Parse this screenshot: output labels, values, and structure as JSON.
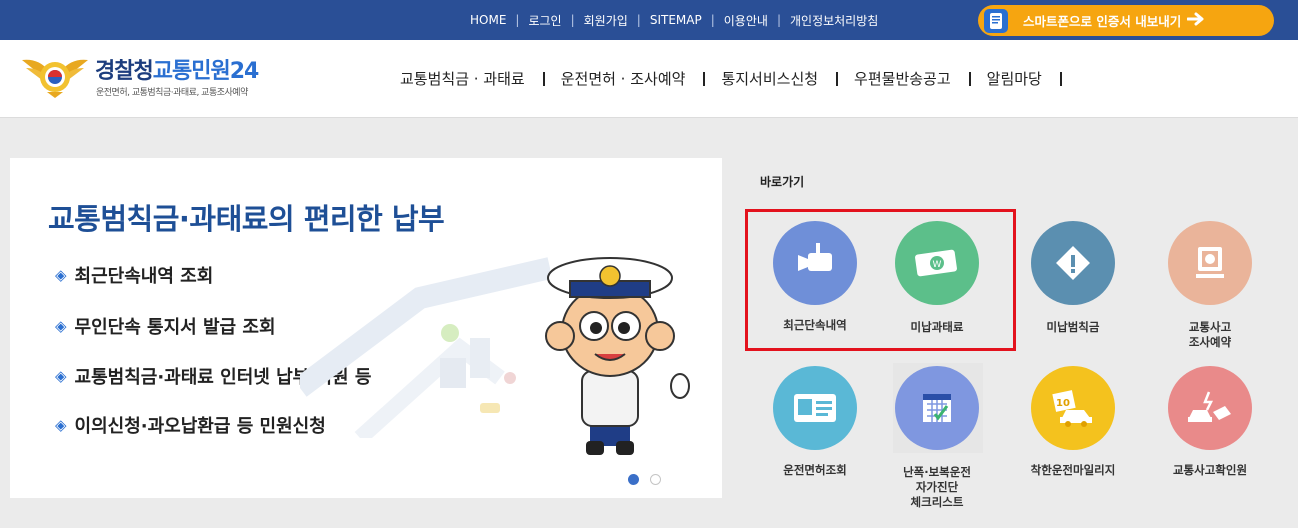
{
  "topbar": {
    "links": [
      "HOME",
      "로그인",
      "회원가입",
      "SITEMAP",
      "이용안내",
      "개인정보처리방침"
    ],
    "smart_label": "스마트폰으로 인증서 내보내기"
  },
  "header": {
    "logo_title_main": "경찰청",
    "logo_title_accent": "교통민원24",
    "logo_subtitle": "운전면허, 교통범칙금·과태료, 교통조사예약",
    "gnb": [
      "교통범칙금 · 과태료",
      "운전면허 · 조사예약",
      "통지서비스신청",
      "우편물반송공고",
      "알림마당"
    ]
  },
  "banner": {
    "title": "교통범칙금·과태료의 편리한 납부",
    "items": [
      "최근단속내역 조회",
      "무인단속 통지서 발급 조회",
      "교통범칙금·과태료 인터넷 납부 지원 등",
      "이의신청·과오납환급 등 민원신청"
    ],
    "bullet": "◈",
    "active_slide": 1,
    "slide_count": 2
  },
  "quick": {
    "title": "바로가기",
    "items": [
      {
        "label": "최근단속내역",
        "icon": "camera-icon",
        "color": "#6f8fd8"
      },
      {
        "label": "미납과태료",
        "icon": "money-icon",
        "color": "#5cbf8a"
      },
      {
        "label": "미납범칙금",
        "icon": "warning-icon",
        "color": "#5b8fb0"
      },
      {
        "label": "교통사고\n조사예약",
        "icon": "computer-icon",
        "color": "#eab49a"
      },
      {
        "label": "운전면허조회",
        "icon": "license-card-icon",
        "color": "#5ab8d6"
      },
      {
        "label": "난폭·보복운전\n자가진단\n체크리스트",
        "icon": "calendar-check-icon",
        "color": "#7f97e0"
      },
      {
        "label": "착한운전마일리지",
        "icon": "mileage-car-icon",
        "color": "#f4c21e"
      },
      {
        "label": "교통사고확인원",
        "icon": "accident-icon",
        "color": "#e98a8a"
      }
    ]
  },
  "colors": {
    "topbar": "#2a4f96",
    "smart_button": "#f6a510",
    "highlight_box": "#e3121d",
    "banner_title": "#1e4f96"
  }
}
